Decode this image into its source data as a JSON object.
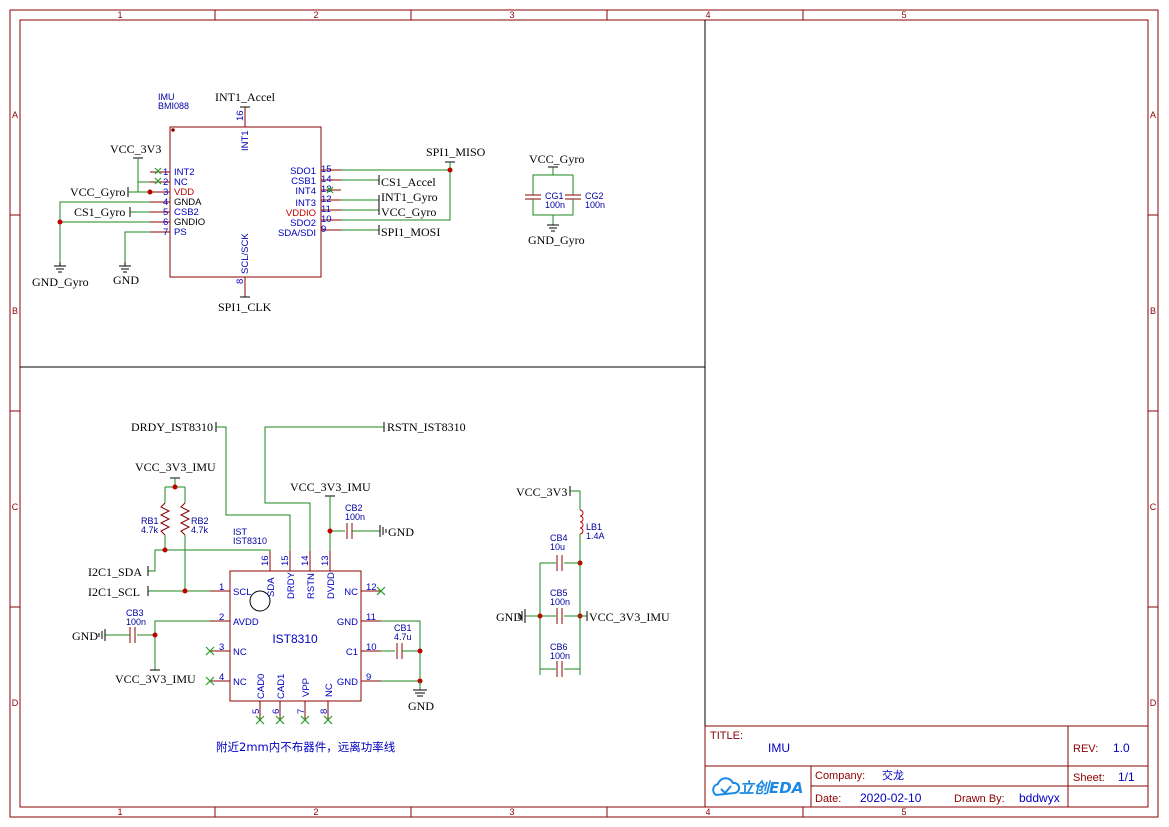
{
  "frame": {
    "columns": [
      "1",
      "2",
      "3",
      "4",
      "5"
    ],
    "rows": [
      "A",
      "B",
      "C",
      "D"
    ]
  },
  "imu_bmi088": {
    "ref": "IMU",
    "value": "BMI088",
    "left_pins": [
      {
        "num": "1",
        "name": "INT2"
      },
      {
        "num": "2",
        "name": "NC"
      },
      {
        "num": "3",
        "name": "VDD"
      },
      {
        "num": "4",
        "name": "GNDA"
      },
      {
        "num": "5",
        "name": "CSB2"
      },
      {
        "num": "6",
        "name": "GNDIO"
      },
      {
        "num": "7",
        "name": "PS"
      }
    ],
    "right_pins": [
      {
        "num": "15",
        "name": "SDO1"
      },
      {
        "num": "14",
        "name": "CSB1"
      },
      {
        "num": "13",
        "name": "INT4"
      },
      {
        "num": "12",
        "name": "INT3"
      },
      {
        "num": "11",
        "name": "VDDIO"
      },
      {
        "num": "10",
        "name": "SDO2"
      },
      {
        "num": "9",
        "name": "SDA/SDI"
      }
    ],
    "top_pin": {
      "num": "16",
      "name": "INT1"
    },
    "bottom_pin": {
      "num": "8",
      "name": "SCL/SCK"
    }
  },
  "nets_a": {
    "int1_accel": "INT1_Accel",
    "vcc_3v3": "VCC_3V3",
    "vcc_gyro": "VCC_Gyro",
    "cs1_gyro": "CS1_Gyro",
    "gnd_gyro": "GND_Gyro",
    "gnd": "GND",
    "spi1_clk": "SPI1_CLK",
    "spi1_miso": "SPI1_MISO",
    "cs1_accel": "CS1_Accel",
    "int1_gyro": "INT1_Gyro",
    "vcc_gyro_r": "VCC_Gyro",
    "spi1_mosi": "SPI1_MOSI"
  },
  "gyro_caps": {
    "vcc": "VCC_Gyro",
    "gnd": "GND_Gyro",
    "cg1_ref": "CG1",
    "cg1_val": "100n",
    "cg2_ref": "CG2",
    "cg2_val": "100n"
  },
  "ist8310": {
    "ref": "IST",
    "value": "IST8310",
    "center_label": "IST8310",
    "left_pins": [
      {
        "num": "1",
        "name": "SCL"
      },
      {
        "num": "2",
        "name": "AVDD"
      },
      {
        "num": "3",
        "name": "NC"
      },
      {
        "num": "4",
        "name": "NC"
      }
    ],
    "top_pins": [
      {
        "num": "16",
        "name": "SDA"
      },
      {
        "num": "15",
        "name": "DRDY"
      },
      {
        "num": "14",
        "name": "RSTN"
      },
      {
        "num": "13",
        "name": "DVDD"
      }
    ],
    "right_pins": [
      {
        "num": "12",
        "name": "NC"
      },
      {
        "num": "11",
        "name": "GND"
      },
      {
        "num": "10",
        "name": "C1"
      },
      {
        "num": "9",
        "name": "GND"
      }
    ],
    "bottom_pins": [
      {
        "num": "5",
        "name": "CAD0"
      },
      {
        "num": "6",
        "name": "CAD1"
      },
      {
        "num": "7",
        "name": "VPP"
      },
      {
        "num": "8",
        "name": "NC"
      }
    ]
  },
  "nets_c": {
    "drdy": "DRDY_IST8310",
    "rstn": "RSTN_IST8310",
    "vcc_3v3_imu_top": "VCC_3V3_IMU",
    "vcc_3v3_imu_mid": "VCC_3V3_IMU",
    "vcc_3v3_imu_bot": "VCC_3V3_IMU",
    "i2c1_sda": "I2C1_SDA",
    "i2c1_scl": "I2C1_SCL",
    "gnd_cb3": "GND",
    "gnd_cb2": "GND",
    "gnd_bottom": "GND",
    "rb1_ref": "RB1",
    "rb1_val": "4.7k",
    "rb2_ref": "RB2",
    "rb2_val": "4.7k",
    "cb2_ref": "CB2",
    "cb2_val": "100n",
    "cb3_ref": "CB3",
    "cb3_val": "100n",
    "cb1_ref": "CB1",
    "cb1_val": "4.7u",
    "note": "附近2mm内不布器件，远离功率线"
  },
  "filter": {
    "vcc_3v3": "VCC_3V3",
    "vcc_3v3_imu": "VCC_3V3_IMU",
    "gnd": "GND",
    "lb1_ref": "LB1",
    "lb1_val": "1.4A",
    "cb4_ref": "CB4",
    "cb4_val": "10u",
    "cb5_ref": "CB5",
    "cb5_val": "100n",
    "cb6_ref": "CB6",
    "cb6_val": "100n"
  },
  "title_block": {
    "title_label": "TITLE:",
    "title": "IMU",
    "rev_label": "REV:",
    "rev": "1.0",
    "company_label": "Company:",
    "company": "交龙",
    "sheet_label": "Sheet:",
    "sheet": "1/1",
    "date_label": "Date:",
    "date": "2020-02-10",
    "drawn_label": "Drawn By:",
    "drawn": "bddwyx",
    "logo_text": "立创EDA",
    "logo_icon": "cloud-icon"
  },
  "colors": {
    "frame": "#8b0000",
    "wire": "#1b8a1b",
    "pin_text": "#0000c0",
    "junction": "#c00000"
  }
}
